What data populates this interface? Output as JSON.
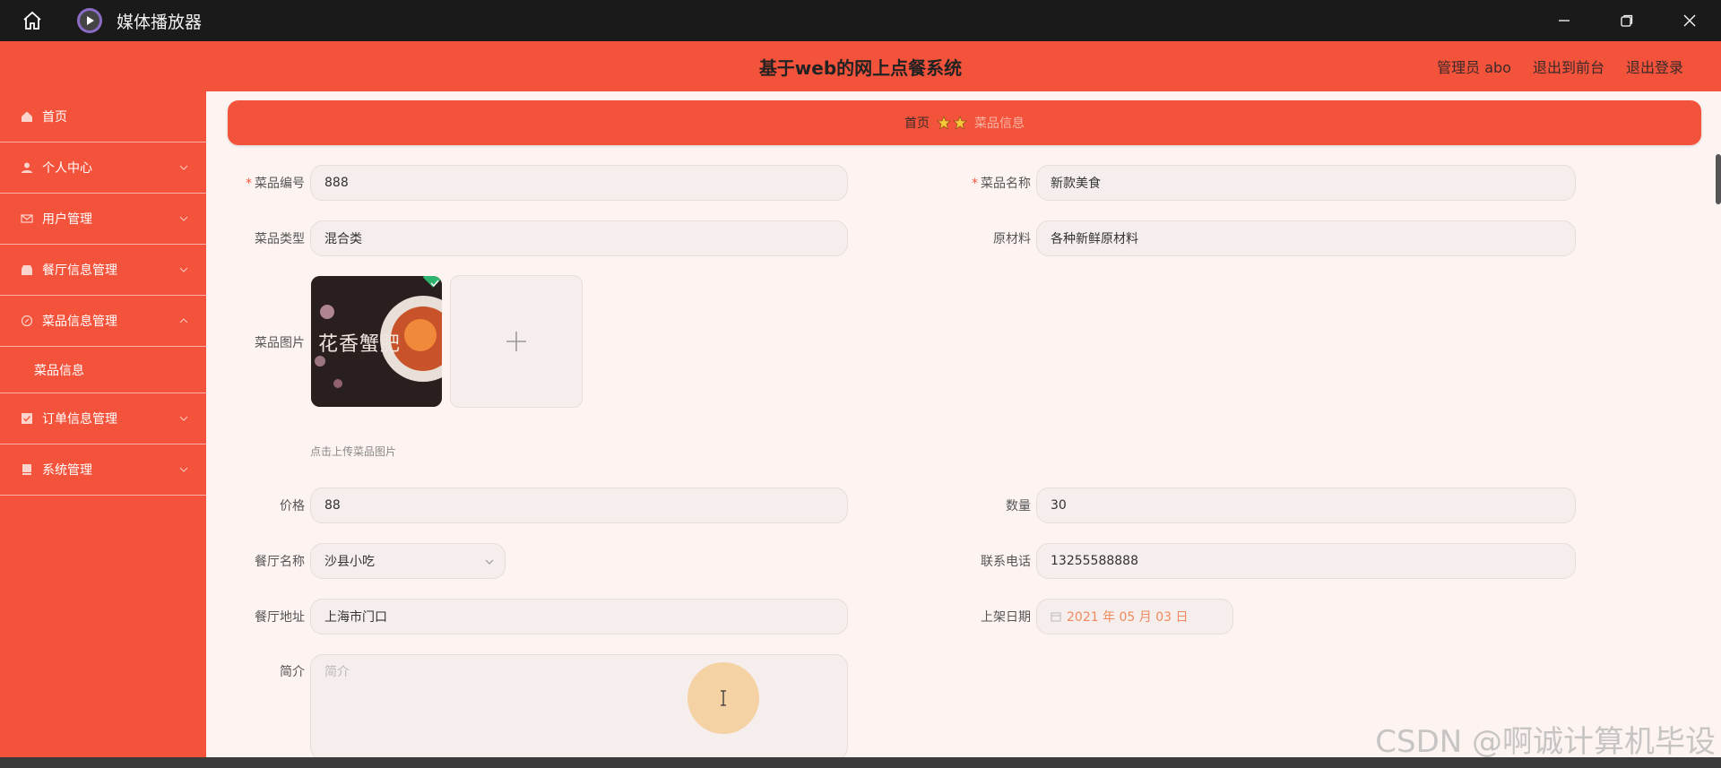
{
  "window": {
    "title": "媒体播放器"
  },
  "header": {
    "title": "基于web的网上点餐系统",
    "admin": "管理员 abo",
    "front": "退出到前台",
    "logout": "退出登录"
  },
  "sidebar": {
    "items": [
      {
        "label": "首页",
        "icon": "home-icon"
      },
      {
        "label": "个人中心",
        "icon": "user-icon"
      },
      {
        "label": "用户管理",
        "icon": "mail-icon"
      },
      {
        "label": "餐厅信息管理",
        "icon": "shop-icon"
      },
      {
        "label": "菜品信息管理",
        "icon": "compass-icon"
      },
      {
        "label": "订单信息管理",
        "icon": "check-icon"
      },
      {
        "label": "系统管理",
        "icon": "book-icon"
      }
    ],
    "sub_item": "菜品信息"
  },
  "breadcrumb": {
    "home": "首页",
    "current": "菜品信息"
  },
  "form": {
    "dish_no": {
      "label": "菜品编号",
      "value": "888"
    },
    "dish_name": {
      "label": "菜品名称",
      "value": "新款美食"
    },
    "dish_type": {
      "label": "菜品类型",
      "value": "混合类"
    },
    "material": {
      "label": "原材料",
      "value": "各种新鲜原材料"
    },
    "image": {
      "label": "菜品图片",
      "tip": "点击上传菜品图片",
      "thumb_text": "花香蟹肥"
    },
    "price": {
      "label": "价格",
      "value": "88"
    },
    "quantity": {
      "label": "数量",
      "value": "30"
    },
    "restaurant": {
      "label": "餐厅名称",
      "value": "沙县小吃"
    },
    "phone": {
      "label": "联系电话",
      "value": "13255588888"
    },
    "address": {
      "label": "餐厅地址",
      "value": "上海市门口"
    },
    "date": {
      "label": "上架日期",
      "value": "2021 年 05 月 03 日"
    },
    "intro": {
      "label": "简介",
      "placeholder": "简介"
    }
  },
  "watermark": "CSDN @啊诚计算机毕设",
  "colors": {
    "primary": "#f4533b",
    "background": "#fdf4f2",
    "titlebar": "#1a1a1a"
  }
}
